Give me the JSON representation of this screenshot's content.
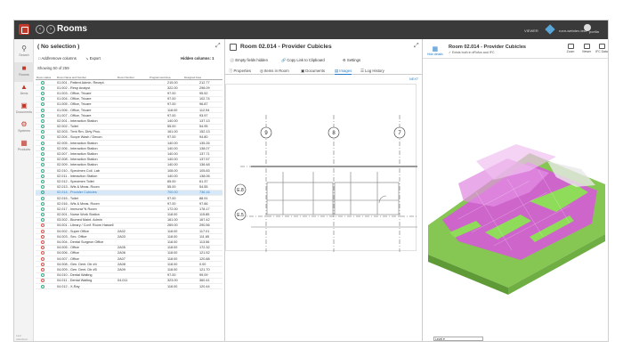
{
  "app": {
    "title": "Rooms",
    "viewer_label": "VIEWER",
    "user": "runn-webdev-test",
    "user_short": "portila"
  },
  "colors": {
    "accent": "#2a7ec8",
    "brand": "#c0392b",
    "status_ok": "#3aa88a",
    "status_bad": "#d9534f",
    "model_magenta": "#d24fd6",
    "model_green": "#8ed15a"
  },
  "sidebar": {
    "items": [
      {
        "label": "Search",
        "icon": "search-icon"
      },
      {
        "label": "Rooms",
        "icon": "room-icon"
      },
      {
        "label": "Items",
        "icon": "items-icon"
      },
      {
        "label": "Documents",
        "icon": "documents-icon"
      },
      {
        "label": "Systems",
        "icon": "systems-icon"
      },
      {
        "label": "Products",
        "icon": "products-icon"
      }
    ],
    "footer": "Last refreshed"
  },
  "list_panel": {
    "title": "( No selection )",
    "add_remove": "Add/remove columns",
    "export": "Export",
    "hidden_columns": "Hidden columns: 1",
    "showing": "Showing 50 of 259",
    "headers": [
      "Room status",
      "Room Name and Number",
      "Room Number",
      "Programmed Area",
      "Designed Area"
    ],
    "rows": [
      {
        "name": "01.001 - Patient Admin. Recept.",
        "num": "",
        "prog": "215.00",
        "des": "212.77",
        "s": "ok"
      },
      {
        "name": "01.002 - Resp Analyst",
        "num": "",
        "prog": "322.00",
        "des": "298.09",
        "s": "ok"
      },
      {
        "name": "01.003 - Office, Tricare",
        "num": "",
        "prog": "97.00",
        "des": "95.52",
        "s": "ok"
      },
      {
        "name": "01.004 - Office, Tricare",
        "num": "",
        "prog": "97.00",
        "des": "102.74",
        "s": "ok"
      },
      {
        "name": "01.005 - Office, Tricare",
        "num": "",
        "prog": "97.00",
        "des": "96.87",
        "s": "ok"
      },
      {
        "name": "01.006 - Office, Tricare",
        "num": "",
        "prog": "118.00",
        "des": "112.94",
        "s": "ok"
      },
      {
        "name": "01.007 - Office, Tricare",
        "num": "",
        "prog": "97.00",
        "des": "93.97",
        "s": "ok"
      },
      {
        "name": "02.001 - Interaction Station",
        "num": "",
        "prog": "140.00",
        "des": "137.13",
        "s": "ok"
      },
      {
        "name": "02.002 - Toilet",
        "num": "",
        "prog": "55.00",
        "des": "54.95",
        "s": "ok"
      },
      {
        "name": "02.003 - Trmt Rm, Dirty Proc.",
        "num": "",
        "prog": "161.00",
        "des": "152.13",
        "s": "ok"
      },
      {
        "name": "02.004 - Scope Wash / Decon.",
        "num": "",
        "prog": "97.00",
        "des": "94.80",
        "s": "ok"
      },
      {
        "name": "02.005 - Interaction Station",
        "num": "",
        "prog": "140.00",
        "des": "135.26",
        "s": "ok"
      },
      {
        "name": "02.006 - Interaction Station",
        "num": "",
        "prog": "140.00",
        "des": "138.07",
        "s": "ok"
      },
      {
        "name": "02.007 - Interaction Station",
        "num": "",
        "prog": "140.00",
        "des": "137.71",
        "s": "ok"
      },
      {
        "name": "02.008 - Interaction Station",
        "num": "",
        "prog": "140.00",
        "des": "137.57",
        "s": "ok"
      },
      {
        "name": "02.009 - Interaction Station",
        "num": "",
        "prog": "140.00",
        "des": "136.48",
        "s": "ok"
      },
      {
        "name": "02.010 - Specimen Coll. Lab",
        "num": "",
        "prog": "108.00",
        "des": "105.83",
        "s": "ok"
      },
      {
        "name": "02.011 - Interaction Station",
        "num": "",
        "prog": "140.00",
        "des": "138.06",
        "s": "ok"
      },
      {
        "name": "02.012 - Specimen Toilet",
        "num": "",
        "prog": "65.00",
        "des": "61.37",
        "s": "ok"
      },
      {
        "name": "02.013 - Wts & Meas. Room",
        "num": "",
        "prog": "55.00",
        "des": "54.55",
        "s": "ok"
      },
      {
        "name": "02.014 - Provider Cubicles",
        "num": "",
        "prog": "700.00",
        "des": "736.16",
        "s": "ok",
        "sel": true
      },
      {
        "name": "02.015 - Toilet",
        "num": "",
        "prog": "97.00",
        "des": "88.91",
        "s": "ok"
      },
      {
        "name": "02.016 - Wts & Meas. Room",
        "num": "",
        "prog": "97.00",
        "des": "97.66",
        "s": "ok"
      },
      {
        "name": "02.017 - Immuniz\"N Room",
        "num": "",
        "prog": "172.00",
        "des": "178.17",
        "s": "ok"
      },
      {
        "name": "02.001 - Nurse Work Station",
        "num": "",
        "prog": "118.00",
        "des": "115.85",
        "s": "ok"
      },
      {
        "name": "03.002 - Biomed Maint. Admin",
        "num": "",
        "prog": "161.00",
        "des": "167.42",
        "s": "ok"
      },
      {
        "name": "04.001 - Library / Conf. Room Hassell",
        "num": "",
        "prog": "269.00",
        "des": "290.56",
        "s": "bad"
      },
      {
        "name": "04.002 - Super Office",
        "num": "2A02",
        "prog": "118.00",
        "des": "117.01",
        "s": "bad"
      },
      {
        "name": "04.003 - Sec. Office",
        "num": "2A03",
        "prog": "118.00",
        "des": "111.65",
        "s": "bad"
      },
      {
        "name": "04.004 - Dental Surgeon Office",
        "num": "",
        "prog": "118.00",
        "des": "113.56",
        "s": "bad"
      },
      {
        "name": "04.005 - Office",
        "num": "2A05",
        "prog": "118.00",
        "des": "172.32",
        "s": "bad"
      },
      {
        "name": "04.006 - Office",
        "num": "2A06",
        "prog": "118.00",
        "des": "121.52",
        "s": "bad"
      },
      {
        "name": "04.007 - Office",
        "num": "2A07",
        "prog": "118.00",
        "des": "120.88",
        "s": "bad"
      },
      {
        "name": "04.008 - Gen. Dent. Dtr #4",
        "num": "2A08",
        "prog": "118.00",
        "des": "0.00",
        "s": "bad"
      },
      {
        "name": "04.009 - Gen. Dent. Dtr #5",
        "num": "2A09",
        "prog": "118.00",
        "des": "121.70",
        "s": "bad"
      },
      {
        "name": "04.010 - Dental Waiting",
        "num": "",
        "prog": "97.00",
        "des": "99.09",
        "s": "ok"
      },
      {
        "name": "04.011 - Dental Waiting",
        "num": "04.011",
        "prog": "323.00",
        "des": "360.41",
        "s": "bad"
      },
      {
        "name": "04.012 - X-Ray",
        "num": "",
        "prog": "118.00",
        "des": "120.44",
        "s": "ok"
      }
    ]
  },
  "detail_panel": {
    "title": "Room 02.014 - Provider Cubicles",
    "options": [
      "Empty fields hidden",
      "Copy Link to Clipboard",
      "Settings"
    ],
    "tabs": [
      "Properties",
      "Items in Room",
      "Documents",
      "Images",
      "Log History"
    ],
    "active_tab": "Images",
    "next": "NEXT",
    "plan_grid_labels": [
      "9",
      "8",
      "7",
      "E.8",
      "E.5"
    ]
  },
  "viewer_panel": {
    "hide_details": "Hide details",
    "title": "Room 02.014 - Provider Cubicles",
    "subtitle": "Exists both in dRofus and IFC",
    "tools": [
      "Zoom",
      "Viewer",
      "IFC Data"
    ],
    "level": "Level"
  }
}
